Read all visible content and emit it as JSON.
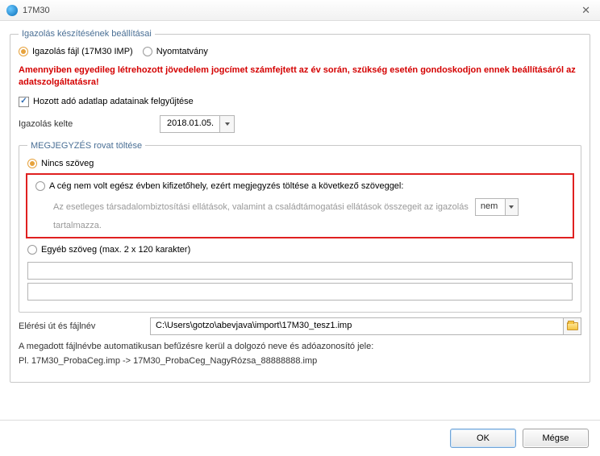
{
  "window": {
    "title": "17M30"
  },
  "group_main": {
    "legend": "Igazolás készítésének beállításai",
    "radios": {
      "file_option": "Igazolás fájl (17M30 IMP)",
      "print_option": "Nyomtatvány"
    },
    "warning": "Amennyiben egyedileg létrehozott jövedelem jogcímet számfejtett az év során, szükség esetén gondoskodjon ennek beállításáról az adatszolgáltatásra!",
    "checkbox_label": "Hozott adó adatlap adatainak felgyűjtése",
    "date": {
      "label": "Igazolás kelte",
      "value": "2018.01.05."
    }
  },
  "group_note": {
    "legend": "MEGJEGYZÉS rovat töltése",
    "opt_none": "Nincs szöveg",
    "opt_not_payer": "A cég nem volt egész évben kifizetőhely, ezért megjegyzés töltése a következő szöveggel:",
    "sub_text_pre": "Az esetleges társadalombiztosítási ellátások, valamint a családtámogatási ellátások összegeit az igazolás",
    "sub_select": "nem",
    "sub_text_post": "tartalmazza.",
    "opt_other": "Egyéb szöveg (max. 2 x 120 karakter)",
    "line1": "",
    "line2": ""
  },
  "path": {
    "label": "Elérési út és fájlnév",
    "value": "C:\\Users\\gotzo\\abevjava\\import\\17M30_tesz1.imp"
  },
  "info": "A megadott fájlnévbe automatikusan befűzésre kerül a dolgozó neve és adóazonosító jele:",
  "example": "Pl. 17M30_ProbaCeg.imp -> 17M30_ProbaCeg_NagyRózsa_88888888.imp",
  "buttons": {
    "ok": "OK",
    "cancel": "Mégse"
  }
}
